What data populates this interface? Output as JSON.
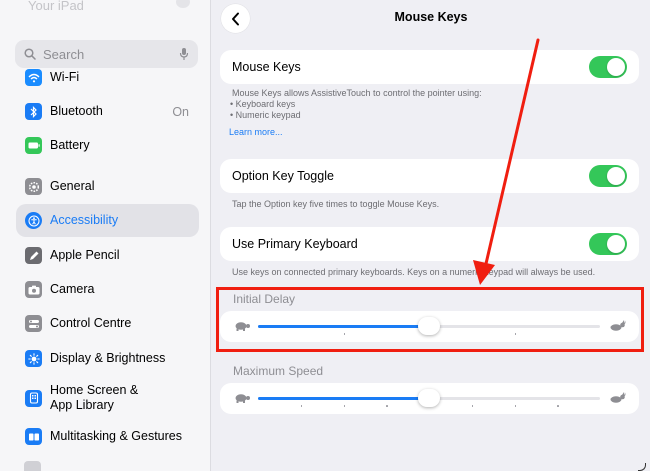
{
  "sidebar": {
    "top_fade_text": "Your iPad",
    "search_placeholder": "Search",
    "items": [
      {
        "label": "Wi-Fi",
        "icon": "wifi-icon",
        "color": "#1a8cff"
      },
      {
        "label": "Bluetooth",
        "icon": "bluetooth-icon",
        "color": "#1a7cf5",
        "value": "On"
      },
      {
        "label": "Battery",
        "icon": "battery-icon",
        "color": "#34c759"
      },
      {
        "label": "General",
        "icon": "gear-icon",
        "color": "#8e8e93"
      },
      {
        "label": "Accessibility",
        "icon": "accessibility-icon",
        "color": "#1a7cf5",
        "selected": true
      },
      {
        "label": "Apple Pencil",
        "icon": "pencil-icon",
        "color": "#6b6b70"
      },
      {
        "label": "Camera",
        "icon": "camera-icon",
        "color": "#8e8e93"
      },
      {
        "label": "Control Centre",
        "icon": "control-centre-icon",
        "color": "#8e8e93"
      },
      {
        "label": "Display & Brightness",
        "icon": "brightness-icon",
        "color": "#1a7cf5"
      },
      {
        "label_line1": "Home Screen &",
        "label_line2": "App Library",
        "icon": "home-screen-icon",
        "color": "#1a7cf5"
      },
      {
        "label": "Multitasking & Gestures",
        "icon": "multitasking-icon",
        "color": "#1a7cf5"
      }
    ]
  },
  "main": {
    "title": "Mouse Keys",
    "mouse_keys": {
      "label": "Mouse Keys",
      "on": true,
      "description": "Mouse Keys allows AssistiveTouch to control the pointer using:",
      "bullets": [
        "Keyboard keys",
        "Numeric keypad"
      ],
      "link": "Learn more..."
    },
    "option_key_toggle": {
      "label": "Option Key Toggle",
      "on": true,
      "description": "Tap the Option key five times to toggle Mouse Keys."
    },
    "use_primary_keyboard": {
      "label": "Use Primary Keyboard",
      "on": true,
      "description": "Use keys on connected primary keyboards. Keys on a numeric keypad will always be used."
    },
    "initial_delay": {
      "label": "Initial Delay",
      "value_fraction": 0.5
    },
    "maximum_speed": {
      "label": "Maximum Speed",
      "value_fraction": 0.5
    }
  },
  "colors": {
    "accent": "#1a7cf5",
    "toggle_on": "#34c759",
    "annotation": "#f01e10"
  }
}
